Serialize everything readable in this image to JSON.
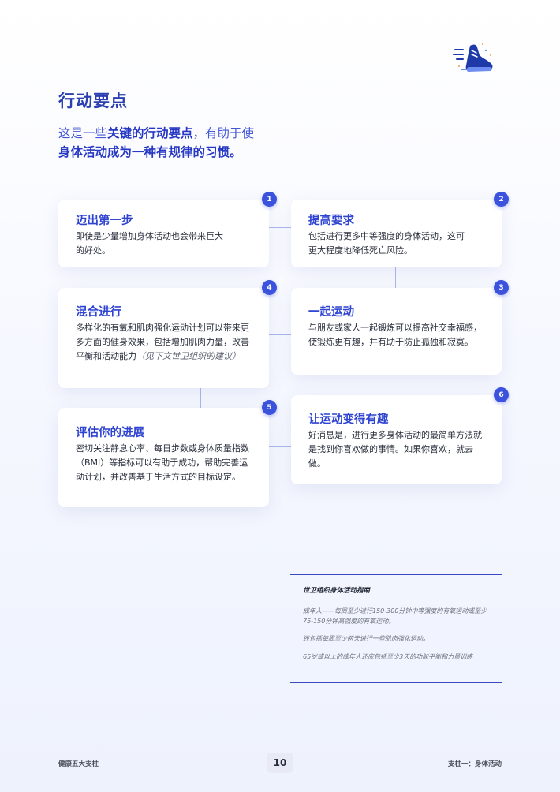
{
  "logo_icon": "running-shoe-icon",
  "title": "行动要点",
  "intro": {
    "part1": "这是一些",
    "bold1": "关键的行动要点",
    "part2": "，有助于使",
    "bold2": "身体活动成为一种有规律的习惯。"
  },
  "cards": [
    {
      "num": "1",
      "title": "迈出第一步",
      "text": "即使是少量增加身体活动也会带来巨大的好处。"
    },
    {
      "num": "2",
      "title": "提高要求",
      "text": "包括进行更多中等强度的身体活动，这可更大程度地降低死亡风险。"
    },
    {
      "num": "3",
      "title": "一起运动",
      "text": "与朋友或家人一起锻炼可以提高社交幸福感，使锻炼更有趣，并有助于防止孤独和寂寞。"
    },
    {
      "num": "4",
      "title": "混合进行",
      "text": "多样化的有氧和肌肉强化运动计划可以带来更多方面的健身效果，包括增加肌肉力量，改善平衡和活动能力",
      "note": "（见下文世卫组织的建议）"
    },
    {
      "num": "5",
      "title": "评估你的进展",
      "text": "密切关注静息心率、每日步数或身体质量指数（BMI）等指标可以有助于成功，帮助完善运动计划，并改善基于生活方式的目标设定。"
    },
    {
      "num": "6",
      "title": "让运动变得有趣",
      "text": "好消息是，进行更多身体活动的最简单方法就是找到你喜欢做的事情。如果你喜欢，就去做。"
    }
  ],
  "guidelines": {
    "title": "世卫组织身体活动指南",
    "items": [
      "成年人——每周至少进行150-300分钟中等强度的有氧运动或至少75-150分钟高强度的有氧运动。",
      "还包括每周至少两天进行一些肌肉强化运动。",
      "65岁或以上的成年人还应包括至少3天的功能平衡和力量训练"
    ]
  },
  "footer": {
    "left": "健康五大支柱",
    "page": "10",
    "right": "支柱一：身体活动"
  },
  "colors": {
    "accent": "#3b52dd",
    "heading": "#2b3fb0",
    "shoe": "#1e3aa8",
    "shoe_light": "#6e8df0"
  }
}
